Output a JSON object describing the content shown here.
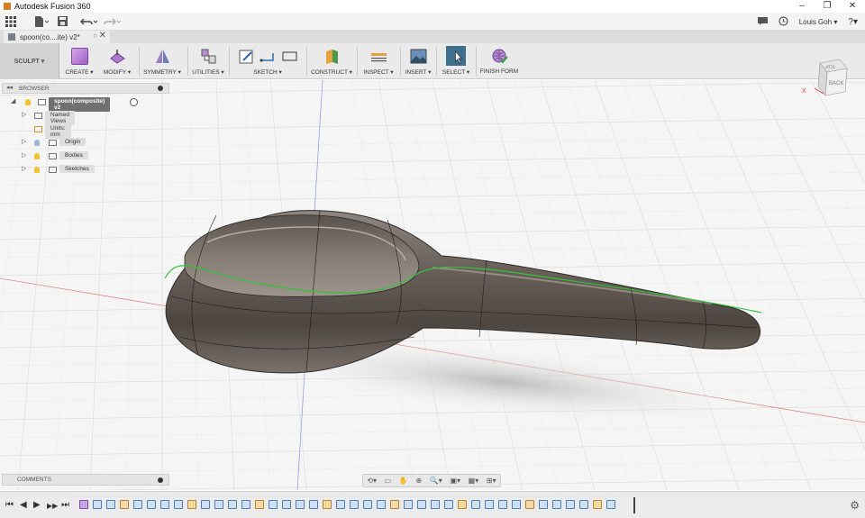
{
  "window": {
    "title": "Autodesk Fusion 360",
    "controls": {
      "minimize": "–",
      "restore": "❐",
      "close": "✕"
    }
  },
  "quick_access": {
    "grid_icon": "apps-grid-icon",
    "file_icon": "file-icon",
    "save_icon": "save-icon",
    "undo_icon": "undo-icon",
    "redo_icon": "redo-icon",
    "user_name": "Louis Goh ▾",
    "help_label": "?▾"
  },
  "document_tab": {
    "label": "spoon(co....ite) v2*",
    "close": "✕"
  },
  "toolbar": {
    "workspace": "SCULPT ▾",
    "groups": [
      {
        "label": "CREATE ▾"
      },
      {
        "label": "MODIFY ▾"
      },
      {
        "label": "SYMMETRY ▾"
      },
      {
        "label": "UTILITIES ▾"
      },
      {
        "label": "SKETCH ▾"
      },
      {
        "label": "CONSTRUCT ▾"
      },
      {
        "label": "INSPECT ▾"
      },
      {
        "label": "INSERT ▾"
      },
      {
        "label": "SELECT ▾"
      },
      {
        "label": "FINISH FORM"
      }
    ]
  },
  "browser": {
    "header": "BROWSER",
    "collapse": "◂◂",
    "root": "spoon(composite) v2",
    "items": [
      {
        "label": "Named Views"
      },
      {
        "label": "Units: mm"
      },
      {
        "label": "Origin"
      },
      {
        "label": "Bodies"
      },
      {
        "label": "Sketches"
      }
    ]
  },
  "comments": {
    "label": "COMMENTS"
  },
  "viewcube": {
    "top_label": "TOP",
    "back_label": "BACK",
    "axis": "X"
  },
  "timeline": {
    "controls": [
      "⏮",
      "◀",
      "▶",
      "▶▶",
      "⏭"
    ],
    "settings_icon": "gear-icon"
  },
  "colors": {
    "background": "#f5f5f5",
    "grid": "#d6d6d6",
    "axis_red": "#e07a7a",
    "axis_blue": "#8a8ae0",
    "body": "#6d655e",
    "edge_green": "#34c13a"
  }
}
